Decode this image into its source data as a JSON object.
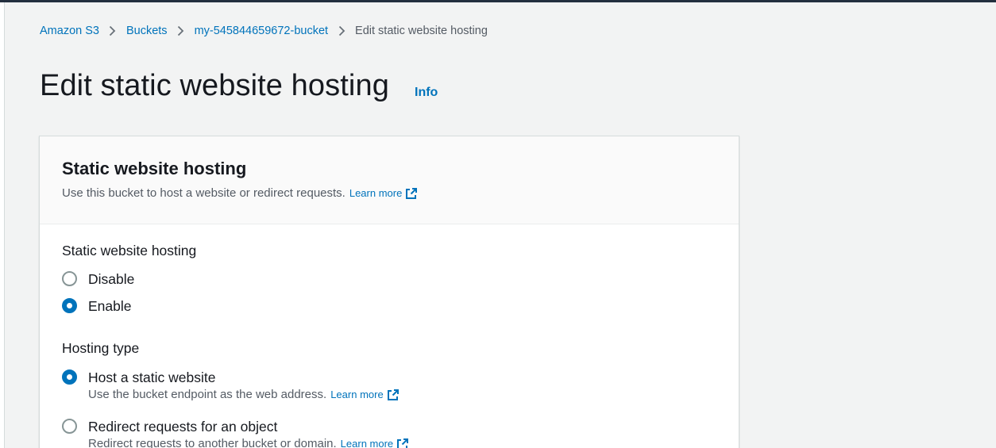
{
  "breadcrumb": {
    "items": [
      "Amazon S3",
      "Buckets",
      "my-545844659672-bucket"
    ],
    "current": "Edit static website hosting"
  },
  "page": {
    "title": "Edit static website hosting",
    "info": "Info"
  },
  "panel": {
    "title": "Static website hosting",
    "description": "Use this bucket to host a website or redirect requests.",
    "learn_more": "Learn more",
    "hosting_field": {
      "label": "Static website hosting",
      "options": [
        "Disable",
        "Enable"
      ],
      "selected": "Enable"
    },
    "hosting_type_field": {
      "label": "Hosting type",
      "options": [
        {
          "label": "Host a static website",
          "description": "Use the bucket endpoint as the web address.",
          "learn_more": "Learn more"
        },
        {
          "label": "Redirect requests for an object",
          "description": "Redirect requests to another bucket or domain.",
          "learn_more": "Learn more"
        }
      ],
      "selected": "Host a static website"
    }
  },
  "colors": {
    "link": "#0073bb",
    "text": "#16191f",
    "secondary_text": "#545b64",
    "background": "#f2f3f3",
    "radio_selected": "#0073bb",
    "radio_unselected": "#879596"
  }
}
